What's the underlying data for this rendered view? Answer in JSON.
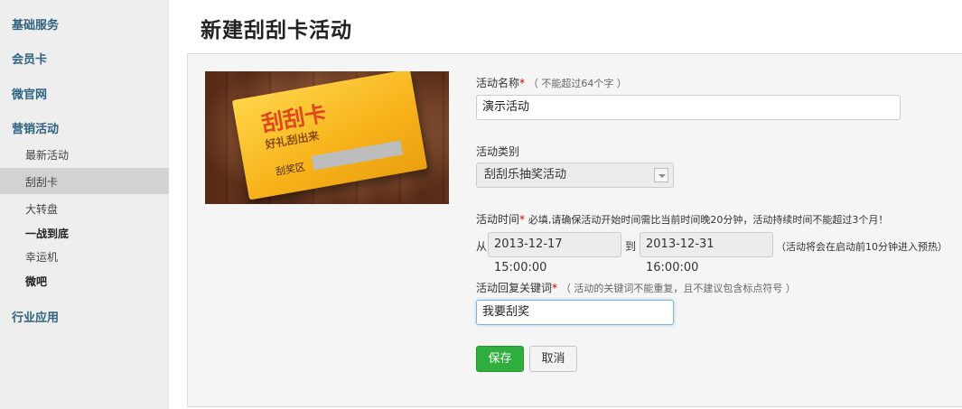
{
  "sidebar": {
    "sections": [
      {
        "label": "基础服务"
      },
      {
        "label": "会员卡"
      },
      {
        "label": "微官网"
      },
      {
        "label": "营销活动"
      },
      {
        "label": "行业应用"
      }
    ],
    "marketing_items": [
      {
        "label": "最新活动"
      },
      {
        "label": "刮刮卡"
      },
      {
        "label": "大转盘"
      },
      {
        "label": "一战到底"
      },
      {
        "label": "幸运机"
      },
      {
        "label": "微吧"
      }
    ]
  },
  "page": {
    "title": "新建刮刮卡活动"
  },
  "card_image": {
    "title": "刮刮卡",
    "subtitle": "好礼刮出来",
    "area_label": "刮奖区"
  },
  "form": {
    "name": {
      "label": "活动名称",
      "required_mark": "*",
      "hint": "（ 不能超过64个字 ）",
      "value": "演示活动"
    },
    "category": {
      "label": "活动类别",
      "value": "刮刮乐抽奖活动"
    },
    "time": {
      "label": "活动时间",
      "required_mark": "*",
      "hint": "必填,请确保活动开始时间需比当前时间晚20分钟，活动持续时间不能超过3个月！",
      "from_label": "从",
      "start": "2013-12-17 15:00:00",
      "to_label": "到",
      "end": "2013-12-31 16:00:00",
      "note": "（活动将会在启动前10分钟进入预热）"
    },
    "keyword": {
      "label": "活动回复关键词",
      "required_mark": "*",
      "hint": "（ 活动的关键词不能重复，且不建议包含标点符号 ）",
      "value": "我要刮奖"
    }
  },
  "buttons": {
    "save": "保存",
    "cancel": "取消"
  },
  "colors": {
    "sidebar_bg": "#eeeeee",
    "section_text": "#2e6380",
    "save_button": "#2fae3e",
    "required": "#cc0000"
  }
}
